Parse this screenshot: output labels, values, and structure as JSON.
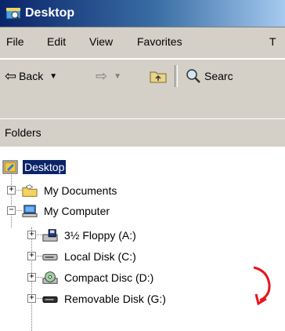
{
  "window": {
    "title": "Desktop"
  },
  "menu": [
    "File",
    "Edit",
    "View",
    "Favorites",
    "T"
  ],
  "toolbar": {
    "back_label": "Back",
    "search_label": "Searc"
  },
  "panel": {
    "title": "Folders"
  },
  "tree": {
    "root": "Desktop",
    "my_documents": "My Documents",
    "my_computer": "My Computer",
    "drives": [
      "3½ Floppy (A:)",
      "Local Disk (C:)",
      "Compact Disc (D:)",
      "Removable Disk (G:)"
    ]
  },
  "colors": {
    "selection": "#0a246a",
    "annotation_arrow": "#e8141e",
    "chrome": "#d4d0c8"
  }
}
